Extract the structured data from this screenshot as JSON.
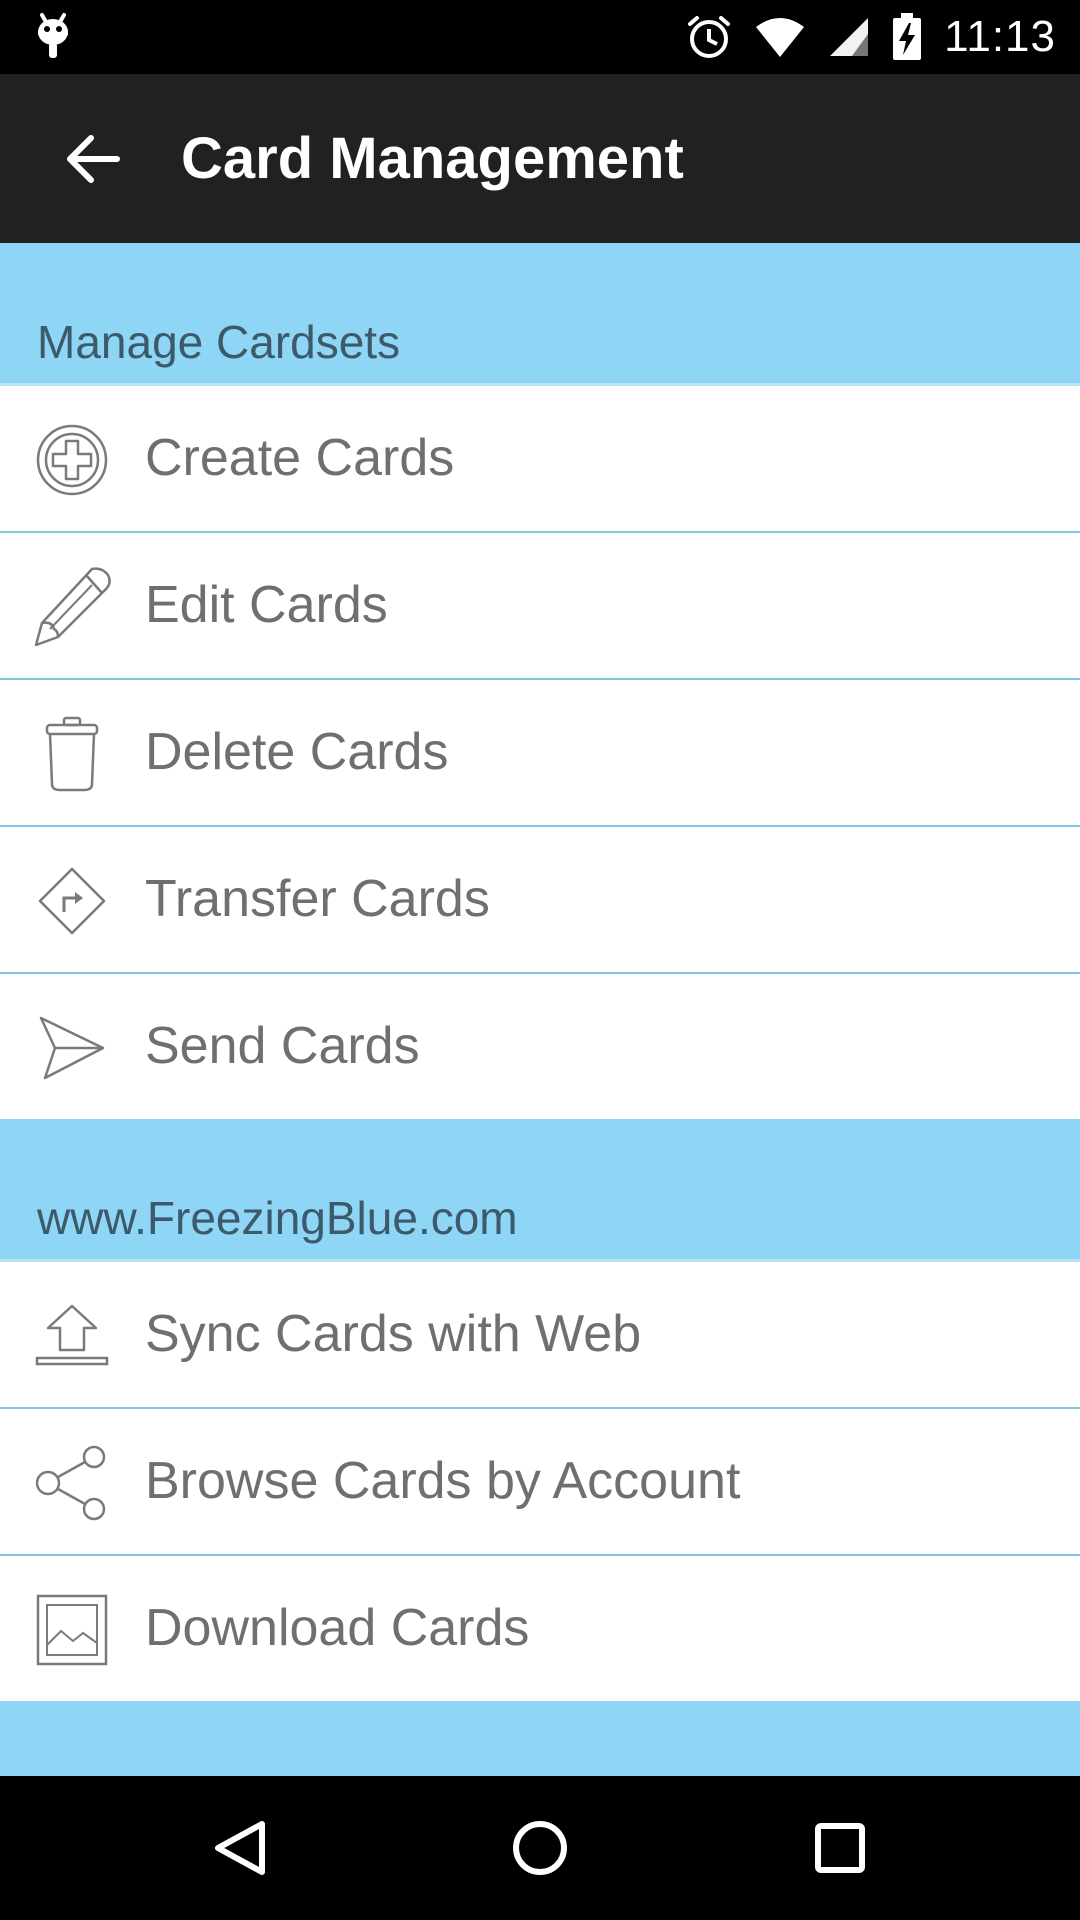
{
  "status_bar": {
    "time": "11:13",
    "icons": [
      "android-debug-icon",
      "alarm-icon",
      "wifi-icon",
      "signal-icon",
      "battery-charging-icon"
    ]
  },
  "toolbar": {
    "title": "Card Management",
    "back_icon": "arrow-left-icon"
  },
  "sections": [
    {
      "title": "Manage Cardsets",
      "items": [
        {
          "label": "Create Cards",
          "icon": "plus-circle-icon"
        },
        {
          "label": "Edit Cards",
          "icon": "pencil-icon"
        },
        {
          "label": "Delete Cards",
          "icon": "trash-icon"
        },
        {
          "label": "Transfer Cards",
          "icon": "turn-right-diamond-icon"
        },
        {
          "label": "Send Cards",
          "icon": "paper-plane-icon"
        }
      ]
    },
    {
      "title": "www.FreezingBlue.com",
      "items": [
        {
          "label": "Sync Cards with Web",
          "icon": "upload-icon"
        },
        {
          "label": "Browse Cards by Account",
          "icon": "share-icon"
        },
        {
          "label": "Download Cards",
          "icon": "image-icon"
        }
      ]
    }
  ],
  "nav_bar": {
    "icons": [
      "back-triangle-icon",
      "home-circle-icon",
      "recents-square-icon"
    ]
  },
  "colors": {
    "section_background": "#8fd6f6",
    "toolbar_background": "#212121",
    "item_text": "#6f6f6f",
    "divider": "#7ec8e6",
    "section_text": "#3c5a69"
  }
}
